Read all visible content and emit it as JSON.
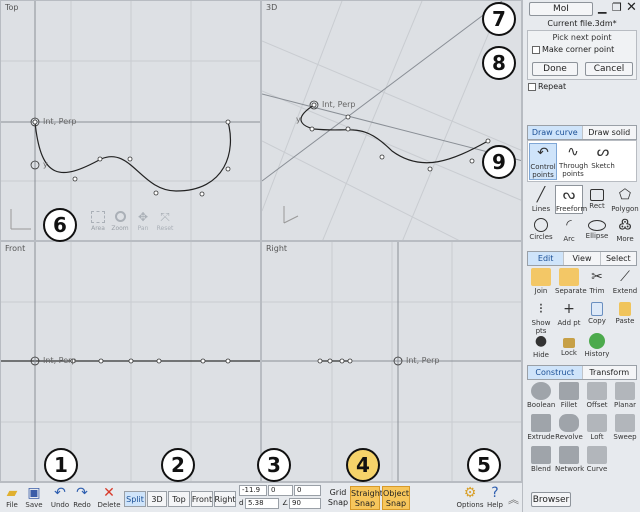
{
  "viewports": {
    "top": {
      "title": "Top",
      "snap_label": "Int, Perp",
      "snap_y": "y"
    },
    "threed": {
      "title": "3D",
      "snap_label": "Int, Perp",
      "snap_y": "y"
    },
    "front": {
      "title": "Front",
      "snap_label": "Int, Perp"
    },
    "right": {
      "title": "Right",
      "snap_label": "Int, Perp"
    },
    "nav": [
      {
        "label": "Area",
        "icon": "area-zoom-icon"
      },
      {
        "label": "Zoom",
        "icon": "magnifier-icon"
      },
      {
        "label": "Pan",
        "icon": "pan-arrows-icon"
      },
      {
        "label": "Reset",
        "icon": "reset-view-icon"
      }
    ]
  },
  "panel": {
    "app_button": "MoI",
    "filename": "Current file.3dm*",
    "prompt": "Pick next point",
    "make_corner": "Make corner point",
    "done": "Done",
    "cancel": "Cancel",
    "repeat": "Repeat",
    "draw_tabs": [
      "Draw curve",
      "Draw solid"
    ],
    "curve_modes": [
      "Control points",
      "Through points",
      "Sketch"
    ],
    "curve_tools": [
      "Lines",
      "Freeform",
      "Rect",
      "Polygon",
      "Circles",
      "Arc",
      "Ellipse",
      "More"
    ],
    "edit_tabs": [
      "Edit",
      "View",
      "Select"
    ],
    "edit_tools": [
      "Join",
      "Separate",
      "Trim",
      "Extend",
      "Show pts",
      "Add pt",
      "Copy",
      "Paste",
      "Hide",
      "Lock",
      "History"
    ],
    "construct_tabs": [
      "Construct",
      "Transform"
    ],
    "construct_tools": [
      "Boolean",
      "Fillet",
      "Offset",
      "Planar",
      "Extrude",
      "Revolve",
      "Loft",
      "Sweep",
      "Blend",
      "Network",
      "Curve"
    ]
  },
  "bottom": {
    "file": "File",
    "save": "Save",
    "undo": "Undo",
    "redo": "Redo",
    "delete": "Delete",
    "views": [
      "Split",
      "3D",
      "Top",
      "Front",
      "Right"
    ],
    "coords": {
      "x": "-11.9",
      "y": "0",
      "z": "0",
      "d_label": "d",
      "d": "5.38",
      "angle_label": "∠",
      "angle": "90"
    },
    "grid_snap": "Grid\nSnap",
    "straight_snap": "Straight\nSnap",
    "object_snap": "Object\nSnap",
    "options": "Options",
    "help": "Help",
    "browser": "Browser"
  },
  "callouts": [
    "1",
    "2",
    "3",
    "4",
    "5",
    "6",
    "7",
    "8",
    "9"
  ],
  "colors": {
    "accent_tab": "#cfe4fa",
    "snap_active": "#f7c65c",
    "viewport_bg": "#dde0e4"
  }
}
